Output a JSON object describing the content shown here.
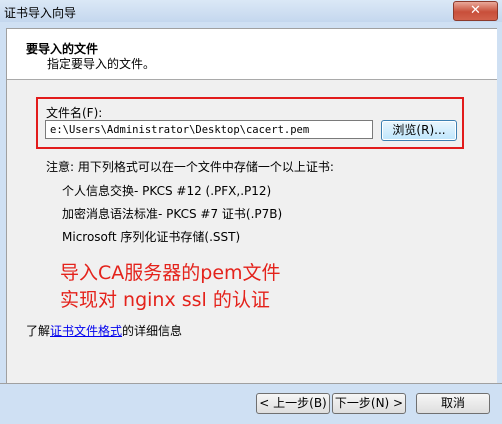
{
  "window": {
    "title": "证书导入向导",
    "close_symbol": "✕"
  },
  "header": {
    "title": "要导入的文件",
    "subtitle": "指定要导入的文件。"
  },
  "file": {
    "label": "文件名(F):",
    "value": "e:\\Users\\Administrator\\Desktop\\cacert.pem",
    "browse_label": "浏览(R)..."
  },
  "note": {
    "title": "注意: 用下列格式可以在一个文件中存储一个以上证书:",
    "formats": [
      "个人信息交换- PKCS #12 (.PFX,.P12)",
      "加密消息语法标准- PKCS #7 证书(.P7B)",
      "Microsoft 序列化证书存储(.SST)"
    ]
  },
  "annotation": {
    "line1": "导入CA服务器的pem文件",
    "line2": "实现对 nginx ssl 的认证"
  },
  "learn_more": {
    "prefix": "了解",
    "link": "证书文件格式",
    "suffix": "的详细信息"
  },
  "buttons": {
    "back": "< 上一步(B)",
    "next": "下一步(N) >",
    "cancel": "取消"
  }
}
